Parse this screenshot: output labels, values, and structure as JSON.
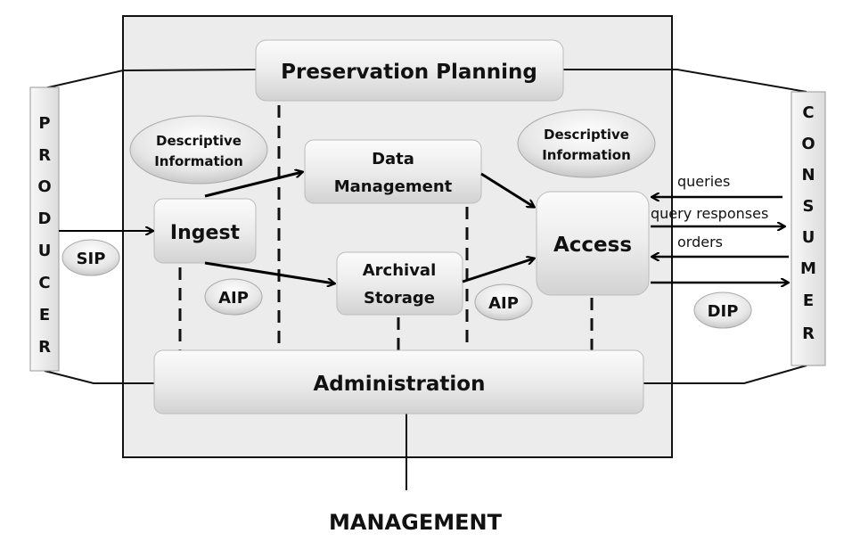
{
  "diagram": {
    "producer_letters": [
      "P",
      "R",
      "O",
      "D",
      "U",
      "C",
      "E",
      "R"
    ],
    "consumer_letters": [
      "C",
      "O",
      "N",
      "S",
      "U",
      "M",
      "E",
      "R"
    ],
    "preservation_planning": "Preservation Planning",
    "descriptive_info_left": [
      "Descriptive",
      "Information"
    ],
    "descriptive_info_right": [
      "Descriptive",
      "Information"
    ],
    "data_management": [
      "Data",
      "Management"
    ],
    "ingest": "Ingest",
    "archival_storage": [
      "Archival",
      "Storage"
    ],
    "access": "Access",
    "administration": "Administration",
    "sip": "SIP",
    "aip_left": "AIP",
    "aip_right": "AIP",
    "dip": "DIP",
    "queries": "queries",
    "query_responses": "query responses",
    "orders": "orders",
    "management": "MANAGEMENT"
  }
}
